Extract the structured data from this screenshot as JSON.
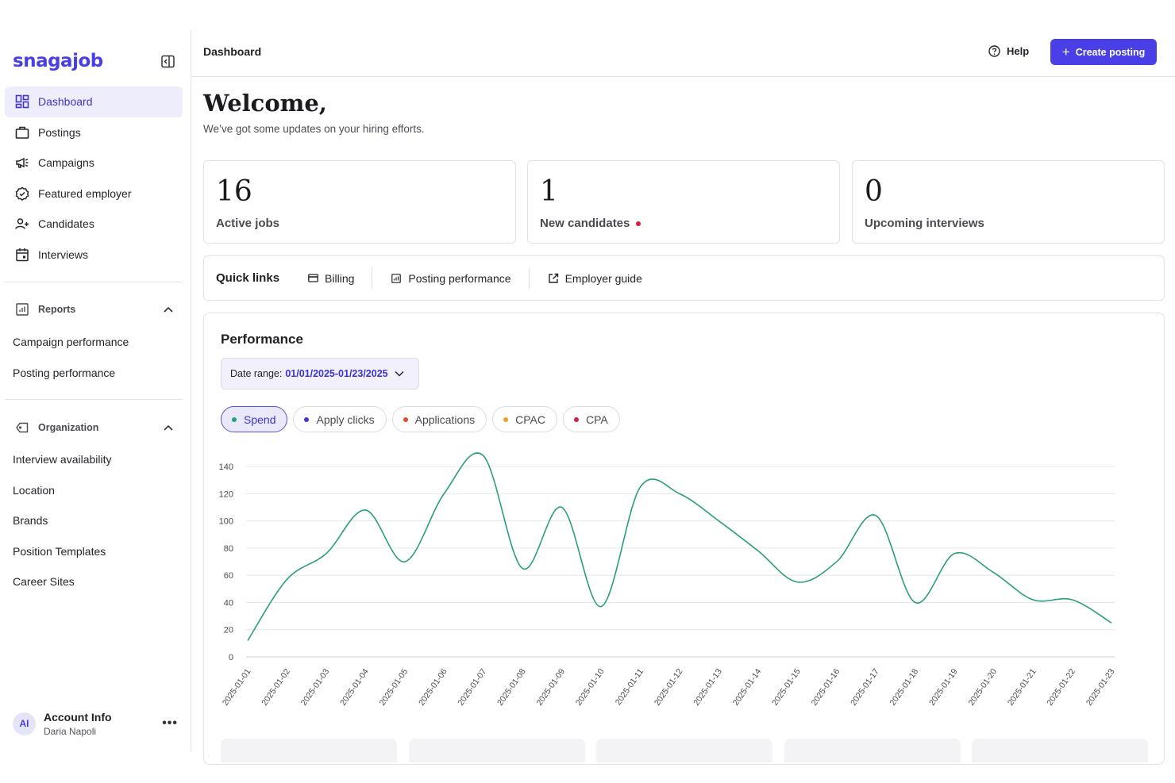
{
  "brand": {
    "logo_text": "snagajob",
    "accent_color": "#4a3fe6"
  },
  "sidebar": {
    "collapse_icon": "sidebar-collapse-icon",
    "nav": [
      {
        "label": "Dashboard",
        "icon": "dashboard-icon",
        "active": true
      },
      {
        "label": "Postings",
        "icon": "briefcase-icon"
      },
      {
        "label": "Campaigns",
        "icon": "megaphone-icon"
      },
      {
        "label": "Featured employer",
        "icon": "badge-check-icon"
      },
      {
        "label": "Candidates",
        "icon": "user-add-icon"
      },
      {
        "label": "Interviews",
        "icon": "calendar-icon"
      }
    ],
    "reports": {
      "title": "Reports",
      "icon": "chart-icon",
      "items": [
        "Campaign performance",
        "Posting performance"
      ]
    },
    "organization": {
      "title": "Organization",
      "icon": "tag-icon",
      "items": [
        "Interview availability",
        "Location",
        "Brands",
        "Position Templates",
        "Career Sites"
      ]
    },
    "account": {
      "initials": "AI",
      "title": "Account Info",
      "name": "Daria Napoli",
      "more": "•••"
    }
  },
  "header": {
    "breadcrumb": "Dashboard",
    "help_label": "Help",
    "create_label": "Create posting"
  },
  "welcome": {
    "title": "Welcome,",
    "subtitle": "We’ve got some updates on your hiring efforts."
  },
  "stats": [
    {
      "value": "16",
      "label": "Active jobs",
      "alert": false
    },
    {
      "value": "1",
      "label": "New candidates",
      "alert": true
    },
    {
      "value": "0",
      "label": "Upcoming interviews",
      "alert": false
    }
  ],
  "quick_links": {
    "title": "Quick links",
    "links": [
      {
        "label": "Billing",
        "icon": "credit-card-icon"
      },
      {
        "label": "Posting performance",
        "icon": "report-icon"
      },
      {
        "label": "Employer guide",
        "icon": "external-link-icon"
      }
    ]
  },
  "performance": {
    "title": "Performance",
    "date_range_label": "Date range:",
    "date_range_value": "01/01/2025-01/23/2025",
    "metrics": [
      {
        "label": "Spend",
        "color": "#2a9d7f",
        "active": true
      },
      {
        "label": "Apply clicks",
        "color": "#3d33d6",
        "active": false
      },
      {
        "label": "Applications",
        "color": "#e8472e",
        "active": false
      },
      {
        "label": "CPAC",
        "color": "#f0a020",
        "active": false
      },
      {
        "label": "CPA",
        "color": "#d81b3b",
        "active": false
      }
    ]
  },
  "chart_data": {
    "type": "line",
    "x": [
      "2025-01-01",
      "2025-01-02",
      "2025-01-03",
      "2025-01-04",
      "2025-01-05",
      "2025-01-06",
      "2025-01-07",
      "2025-01-08",
      "2025-01-09",
      "2025-01-10",
      "2025-01-11",
      "2025-01-12",
      "2025-01-13",
      "2025-01-14",
      "2025-01-15",
      "2025-01-16",
      "2025-01-17",
      "2025-01-18",
      "2025-01-19",
      "2025-01-20",
      "2025-01-21",
      "2025-01-22",
      "2025-01-23"
    ],
    "series": [
      {
        "name": "Spend",
        "color": "#2a9d7f",
        "values": [
          12,
          57,
          76,
          108,
          70,
          120,
          148,
          65,
          110,
          37,
          125,
          120,
          100,
          78,
          55,
          70,
          104,
          40,
          76,
          62,
          42,
          42,
          25
        ]
      }
    ],
    "yticks": [
      0,
      20,
      40,
      60,
      80,
      100,
      120,
      140
    ],
    "ylim": [
      0,
      150
    ],
    "grid": true
  }
}
